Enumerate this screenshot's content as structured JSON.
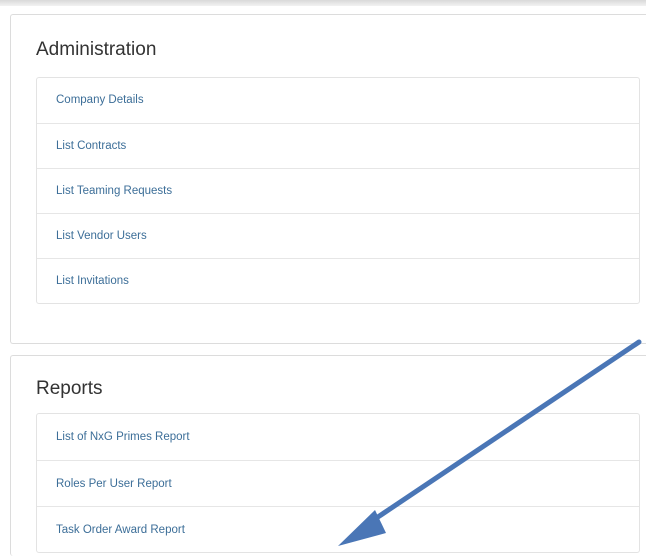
{
  "administration": {
    "title": "Administration",
    "items": [
      {
        "label": "Company Details"
      },
      {
        "label": "List Contracts"
      },
      {
        "label": "List Teaming Requests"
      },
      {
        "label": "List Vendor Users"
      },
      {
        "label": "List Invitations"
      }
    ]
  },
  "reports": {
    "title": "Reports",
    "items": [
      {
        "label": "List of NxG Primes Report"
      },
      {
        "label": "Roles Per User Report"
      },
      {
        "label": "Task Order Award Report"
      }
    ]
  },
  "colors": {
    "link": "#3c6e98",
    "heading": "#333333",
    "border": "#dcdcdc",
    "annotation_arrow": "#4a76b6"
  },
  "icons": {
    "annotation": "arrow-pointer-icon"
  }
}
